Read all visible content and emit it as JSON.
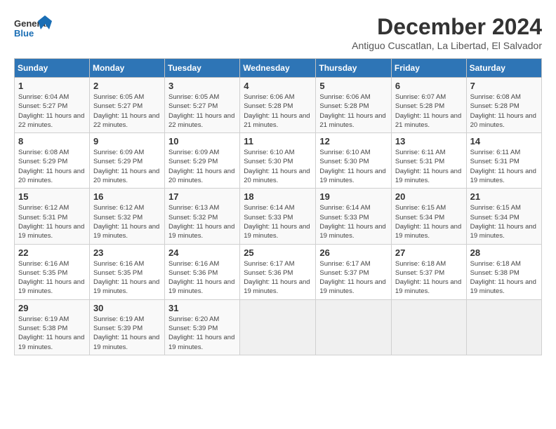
{
  "header": {
    "logo_general": "General",
    "logo_blue": "Blue",
    "title": "December 2024",
    "subtitle": "Antiguo Cuscatlan, La Libertad, El Salvador"
  },
  "weekdays": [
    "Sunday",
    "Monday",
    "Tuesday",
    "Wednesday",
    "Thursday",
    "Friday",
    "Saturday"
  ],
  "weeks": [
    [
      {
        "day": "1",
        "info": "Sunrise: 6:04 AM\nSunset: 5:27 PM\nDaylight: 11 hours and 22 minutes."
      },
      {
        "day": "2",
        "info": "Sunrise: 6:05 AM\nSunset: 5:27 PM\nDaylight: 11 hours and 22 minutes."
      },
      {
        "day": "3",
        "info": "Sunrise: 6:05 AM\nSunset: 5:27 PM\nDaylight: 11 hours and 22 minutes."
      },
      {
        "day": "4",
        "info": "Sunrise: 6:06 AM\nSunset: 5:28 PM\nDaylight: 11 hours and 21 minutes."
      },
      {
        "day": "5",
        "info": "Sunrise: 6:06 AM\nSunset: 5:28 PM\nDaylight: 11 hours and 21 minutes."
      },
      {
        "day": "6",
        "info": "Sunrise: 6:07 AM\nSunset: 5:28 PM\nDaylight: 11 hours and 21 minutes."
      },
      {
        "day": "7",
        "info": "Sunrise: 6:08 AM\nSunset: 5:28 PM\nDaylight: 11 hours and 20 minutes."
      }
    ],
    [
      {
        "day": "8",
        "info": "Sunrise: 6:08 AM\nSunset: 5:29 PM\nDaylight: 11 hours and 20 minutes."
      },
      {
        "day": "9",
        "info": "Sunrise: 6:09 AM\nSunset: 5:29 PM\nDaylight: 11 hours and 20 minutes."
      },
      {
        "day": "10",
        "info": "Sunrise: 6:09 AM\nSunset: 5:29 PM\nDaylight: 11 hours and 20 minutes."
      },
      {
        "day": "11",
        "info": "Sunrise: 6:10 AM\nSunset: 5:30 PM\nDaylight: 11 hours and 20 minutes."
      },
      {
        "day": "12",
        "info": "Sunrise: 6:10 AM\nSunset: 5:30 PM\nDaylight: 11 hours and 19 minutes."
      },
      {
        "day": "13",
        "info": "Sunrise: 6:11 AM\nSunset: 5:31 PM\nDaylight: 11 hours and 19 minutes."
      },
      {
        "day": "14",
        "info": "Sunrise: 6:11 AM\nSunset: 5:31 PM\nDaylight: 11 hours and 19 minutes."
      }
    ],
    [
      {
        "day": "15",
        "info": "Sunrise: 6:12 AM\nSunset: 5:31 PM\nDaylight: 11 hours and 19 minutes."
      },
      {
        "day": "16",
        "info": "Sunrise: 6:12 AM\nSunset: 5:32 PM\nDaylight: 11 hours and 19 minutes."
      },
      {
        "day": "17",
        "info": "Sunrise: 6:13 AM\nSunset: 5:32 PM\nDaylight: 11 hours and 19 minutes."
      },
      {
        "day": "18",
        "info": "Sunrise: 6:14 AM\nSunset: 5:33 PM\nDaylight: 11 hours and 19 minutes."
      },
      {
        "day": "19",
        "info": "Sunrise: 6:14 AM\nSunset: 5:33 PM\nDaylight: 11 hours and 19 minutes."
      },
      {
        "day": "20",
        "info": "Sunrise: 6:15 AM\nSunset: 5:34 PM\nDaylight: 11 hours and 19 minutes."
      },
      {
        "day": "21",
        "info": "Sunrise: 6:15 AM\nSunset: 5:34 PM\nDaylight: 11 hours and 19 minutes."
      }
    ],
    [
      {
        "day": "22",
        "info": "Sunrise: 6:16 AM\nSunset: 5:35 PM\nDaylight: 11 hours and 19 minutes."
      },
      {
        "day": "23",
        "info": "Sunrise: 6:16 AM\nSunset: 5:35 PM\nDaylight: 11 hours and 19 minutes."
      },
      {
        "day": "24",
        "info": "Sunrise: 6:16 AM\nSunset: 5:36 PM\nDaylight: 11 hours and 19 minutes."
      },
      {
        "day": "25",
        "info": "Sunrise: 6:17 AM\nSunset: 5:36 PM\nDaylight: 11 hours and 19 minutes."
      },
      {
        "day": "26",
        "info": "Sunrise: 6:17 AM\nSunset: 5:37 PM\nDaylight: 11 hours and 19 minutes."
      },
      {
        "day": "27",
        "info": "Sunrise: 6:18 AM\nSunset: 5:37 PM\nDaylight: 11 hours and 19 minutes."
      },
      {
        "day": "28",
        "info": "Sunrise: 6:18 AM\nSunset: 5:38 PM\nDaylight: 11 hours and 19 minutes."
      }
    ],
    [
      {
        "day": "29",
        "info": "Sunrise: 6:19 AM\nSunset: 5:38 PM\nDaylight: 11 hours and 19 minutes."
      },
      {
        "day": "30",
        "info": "Sunrise: 6:19 AM\nSunset: 5:39 PM\nDaylight: 11 hours and 19 minutes."
      },
      {
        "day": "31",
        "info": "Sunrise: 6:20 AM\nSunset: 5:39 PM\nDaylight: 11 hours and 19 minutes."
      },
      null,
      null,
      null,
      null
    ]
  ]
}
